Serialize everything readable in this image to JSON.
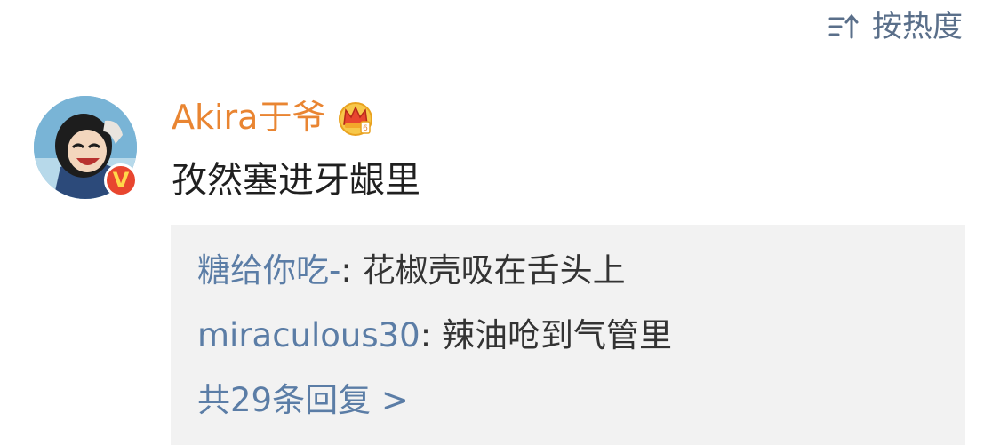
{
  "sort": {
    "label": "按热度",
    "icon": "sort-icon"
  },
  "comment": {
    "username": "Akira于爷",
    "user_badge_icon": "crown-vip-icon",
    "verified_badge": "V",
    "text": "孜然塞进牙龈里"
  },
  "replies": [
    {
      "author": "糖给你吃-",
      "separator": ": ",
      "text": "花椒壳吸在舌头上"
    },
    {
      "author": "miraculous30",
      "separator": ": ",
      "text": "辣油呛到气管里"
    }
  ],
  "more_replies": "共29条回复 >",
  "colors": {
    "username": "#e98532",
    "link": "#5b7da6",
    "reply_bg": "#f2f2f2",
    "sort": "#5a6f8a"
  }
}
